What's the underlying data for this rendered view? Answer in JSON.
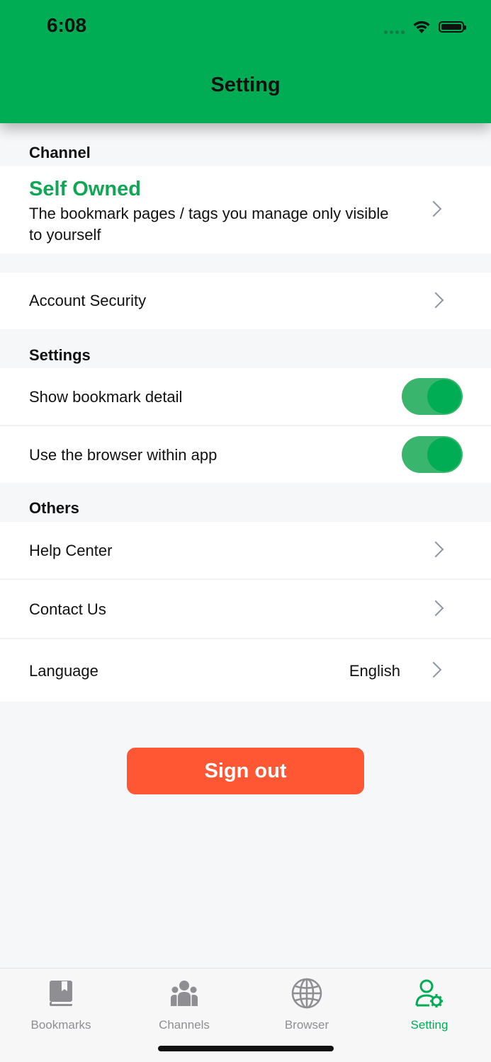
{
  "status_bar": {
    "time": "6:08"
  },
  "header": {
    "title": "Setting"
  },
  "channel_section": {
    "title": "Channel",
    "selected_title": "Self Owned",
    "selected_description": "The bookmark pages / tags you manage only visible to yourself"
  },
  "account": {
    "security_label": "Account Security"
  },
  "settings_section": {
    "title": "Settings",
    "show_bookmark_detail": {
      "label": "Show bookmark detail",
      "enabled": true
    },
    "use_browser_within_app": {
      "label": "Use the browser within app",
      "enabled": true
    }
  },
  "others_section": {
    "title": "Others",
    "help_center": "Help Center",
    "contact_us": "Contact Us",
    "language_label": "Language",
    "language_value": "English"
  },
  "sign_out_label": "Sign out",
  "tabbar": {
    "items": [
      {
        "label": "Bookmarks",
        "icon": "book-icon",
        "active": false
      },
      {
        "label": "Channels",
        "icon": "group-icon",
        "active": false
      },
      {
        "label": "Browser",
        "icon": "globe-icon",
        "active": false
      },
      {
        "label": "Setting",
        "icon": "user-gear-icon",
        "active": true
      }
    ]
  },
  "colors": {
    "brand_green": "#00ad55",
    "toggle_track": "#3ab56e",
    "sign_out": "#ff5733",
    "inactive_tab": "#8e8e93"
  }
}
